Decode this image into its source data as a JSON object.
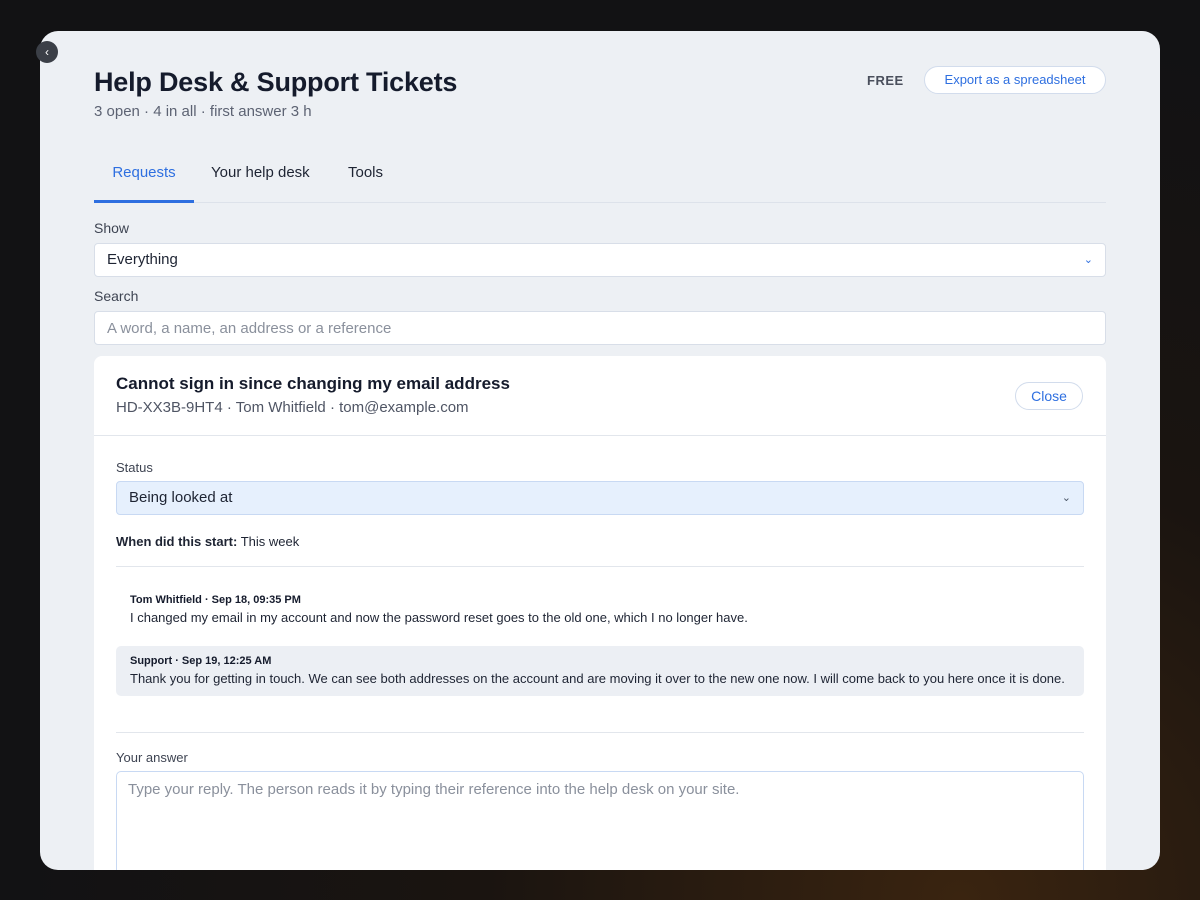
{
  "header": {
    "title": "Help Desk & Support Tickets",
    "subtitle": "3 open · 4 in all · first answer 3 h",
    "plan_badge": "FREE",
    "export_label": "Export as a spreadsheet"
  },
  "tabs": [
    {
      "label": "Requests",
      "active": true
    },
    {
      "label": "Your help desk",
      "active": false
    },
    {
      "label": "Tools",
      "active": false
    }
  ],
  "filters": {
    "show_label": "Show",
    "show_value": "Everything",
    "search_label": "Search",
    "search_placeholder": "A word, a name, an address or a reference"
  },
  "ticket": {
    "title": "Cannot sign in since changing my email address",
    "meta": "HD-XX3B-9HT4 · Tom Whitfield · tom@example.com",
    "close_label": "Close",
    "status_label": "Status",
    "status_value": "Being looked at",
    "started_label": "When did this start:",
    "started_value": "This week",
    "messages": [
      {
        "header": "Tom Whitfield · Sep 18, 09:35 PM",
        "body": "I changed my email in my account and now the password reset goes to the old one, which I no longer have.",
        "from_support": false
      },
      {
        "header": "Support · Sep 19, 12:25 AM",
        "body": "Thank you for getting in touch. We can see both addresses on the account and are moving it over to the new one now. I will come back to you here once it is done.",
        "from_support": true
      }
    ],
    "answer_label": "Your answer",
    "answer_placeholder": "Type your reply. The person reads it by typing their reference into the help desk on your site."
  },
  "icons": {
    "collapse": "chevron-left-icon",
    "dropdown": "chevron-down-icon"
  },
  "colors": {
    "accent": "#2e6fe0",
    "panel_bg": "#edf0f4",
    "status_bg": "#e6f0fd"
  }
}
